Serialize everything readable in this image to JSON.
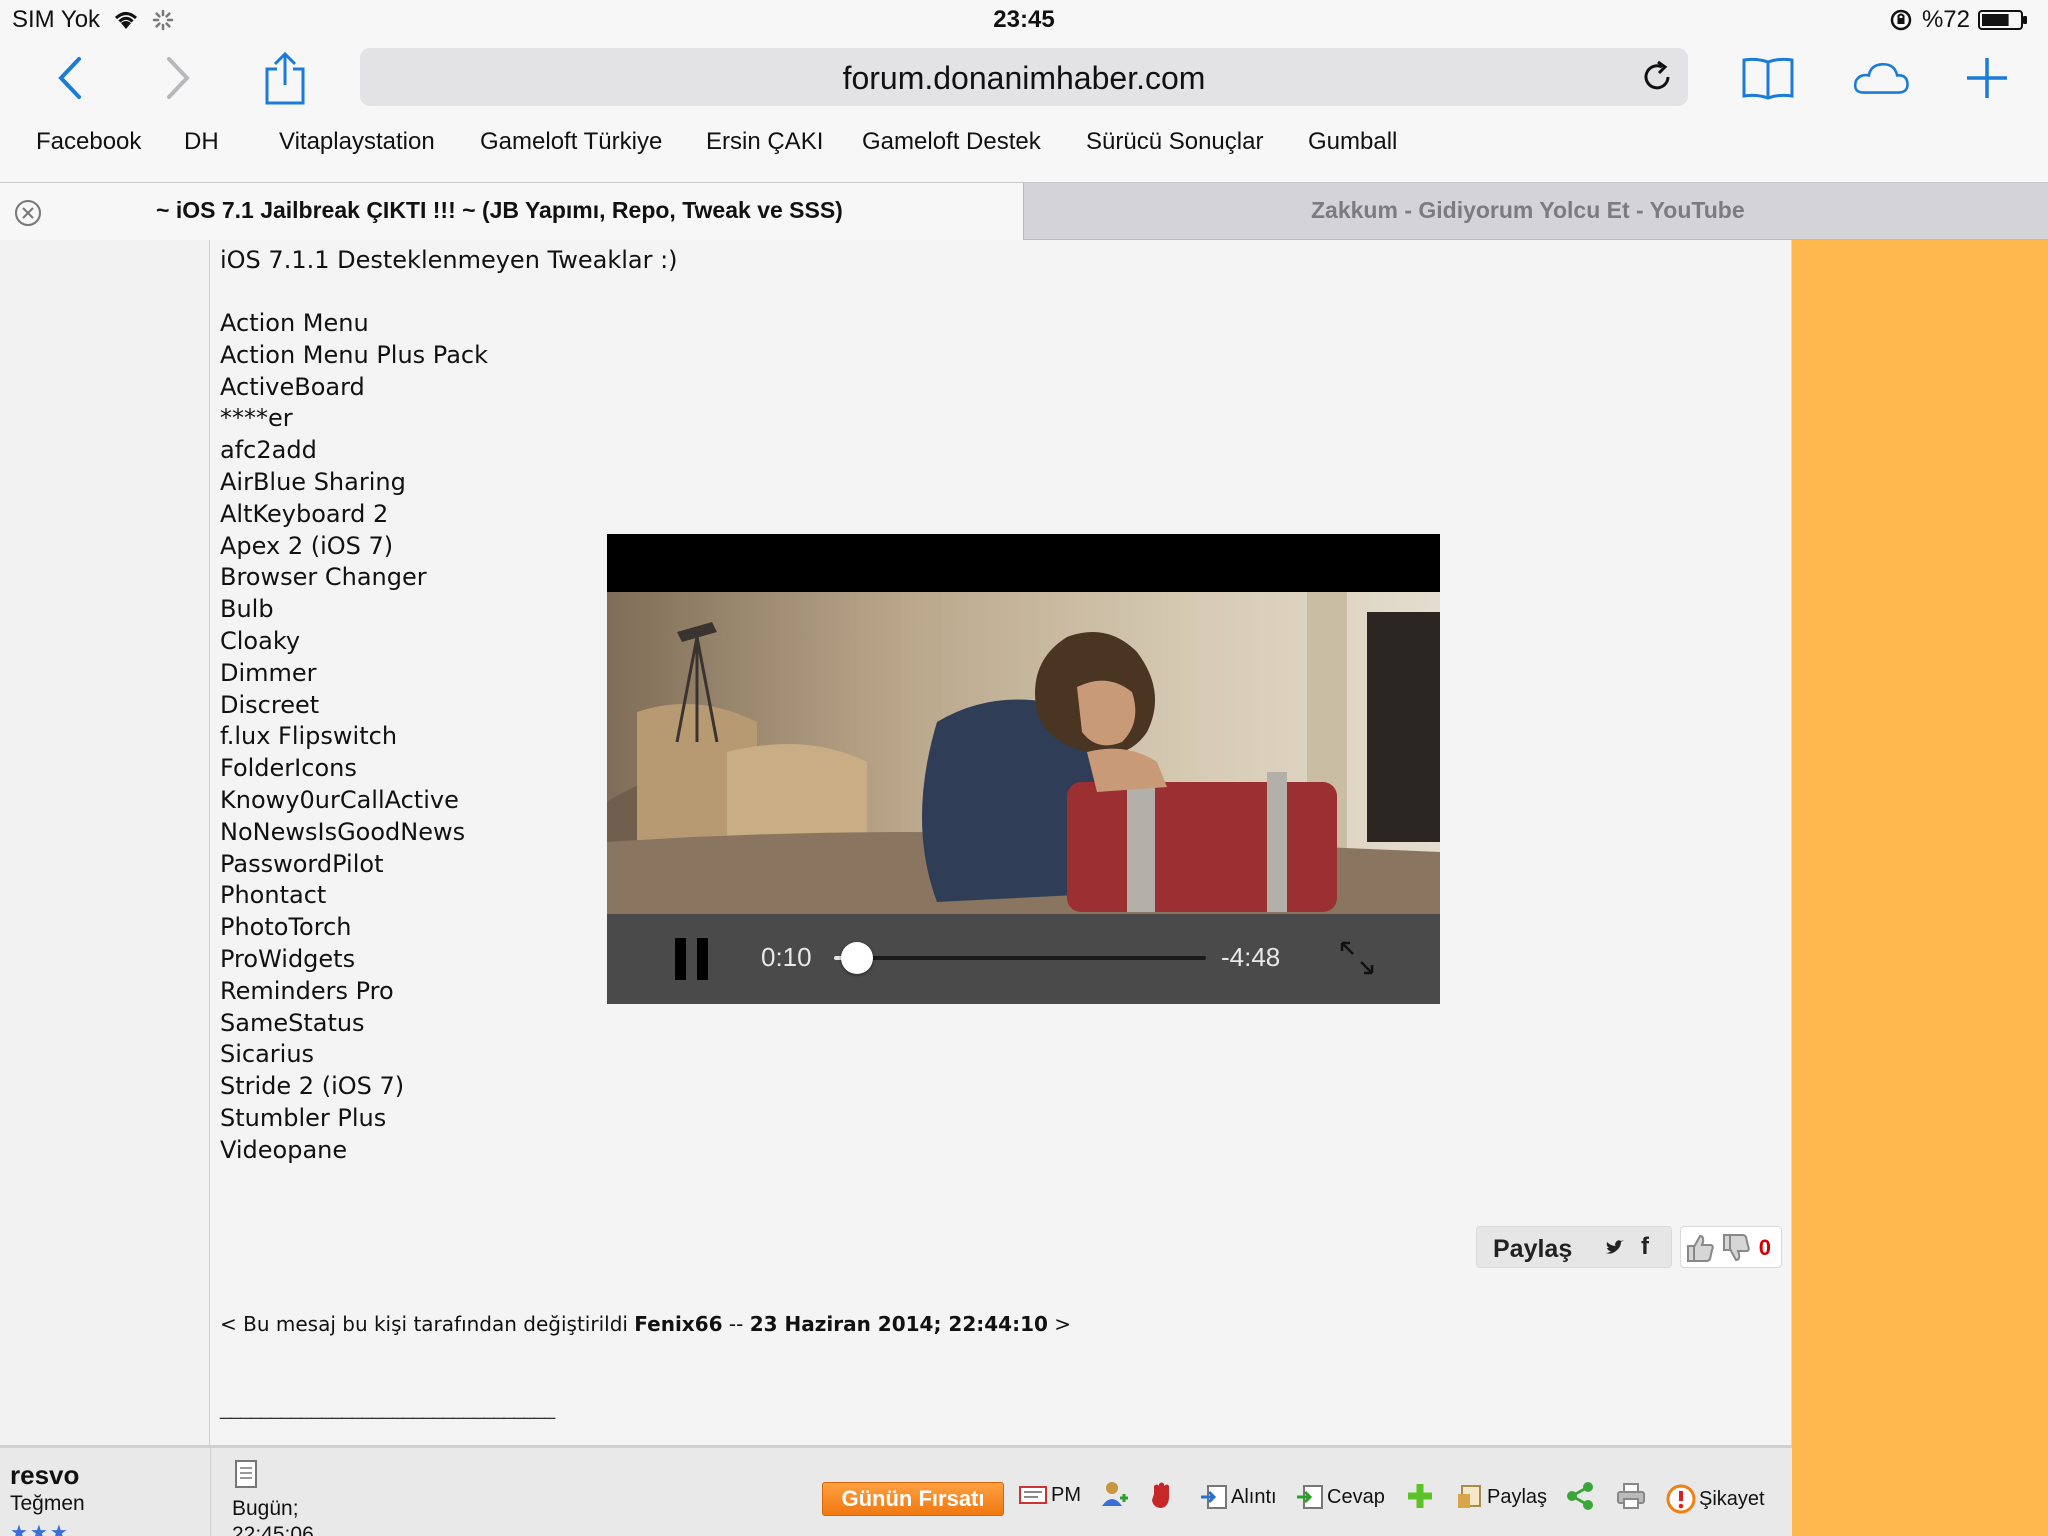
{
  "status_bar": {
    "carrier": "SIM Yok",
    "time": "23:45",
    "battery": "%72",
    "battery_level": 0.72
  },
  "browser": {
    "url": "forum.donanimhaber.com",
    "bookmarks": [
      "Facebook",
      "DH",
      "Vitaplaystation",
      "Gameloft Türkiye",
      "Ersin ÇAKI",
      "Gameloft Destek",
      "Sürücü Sonuçlar",
      "Gumball"
    ],
    "tabs": [
      {
        "title": "~ iOS 7.1 Jailbreak ÇIKTI !!! ~ (JB Yapımı, Repo, Tweak ve SSS)",
        "active": true
      },
      {
        "title": "Zakkum - Gidiyorum Yolcu Et - YouTube",
        "active": false
      }
    ]
  },
  "post": {
    "heading": "iOS 7.1.1 Desteklenmeyen Tweaklar :)",
    "tweaks": [
      "Action Menu",
      "Action Menu Plus Pack",
      "ActiveBoard",
      "****er",
      "afc2add",
      "AirBlue Sharing",
      "AltKeyboard 2",
      "Apex 2 (iOS 7)",
      "Browser Changer",
      "Bulb",
      "Cloaky",
      "Dimmer",
      "Discreet",
      "f.lux Flipswitch",
      "FolderIcons",
      "Knowy0urCallActive",
      "NoNewsIsGoodNews",
      "PasswordPilot",
      "Phontact",
      "PhotoTorch",
      "ProWidgets",
      "Reminders Pro",
      "SameStatus",
      "Sicarius",
      "Stride 2 (iOS 7)",
      "Stumbler Plus",
      "Videopane"
    ],
    "share_label": "Paylaş",
    "vote_count": "0",
    "edit_note": {
      "prefix": "< Bu mesaj bu kişi tarafından değiştirildi ",
      "user": "Fenix66",
      "separator": " -- ",
      "date": "23 Haziran 2014; 22:44:10",
      "suffix": " >"
    },
    "signature_line": "_________________________________"
  },
  "video": {
    "elapsed": "0:10",
    "remaining": "-4:48",
    "progress": 0.034
  },
  "next_post": {
    "username": "resvo",
    "rank": "Teğmen",
    "stars": "★★★",
    "date_label": "Bugün;",
    "time": "22:45:06",
    "deal_button": "Günün Fırsatı",
    "actions": {
      "pm": "PM",
      "quote": "Alıntı",
      "reply": "Cevap",
      "share": "Paylaş",
      "report": "Şikayet"
    }
  },
  "colors": {
    "accent": "#1a7bd8",
    "page_side": "#ffb84d",
    "deal": "#f58a1f",
    "vote": "#d40000"
  }
}
